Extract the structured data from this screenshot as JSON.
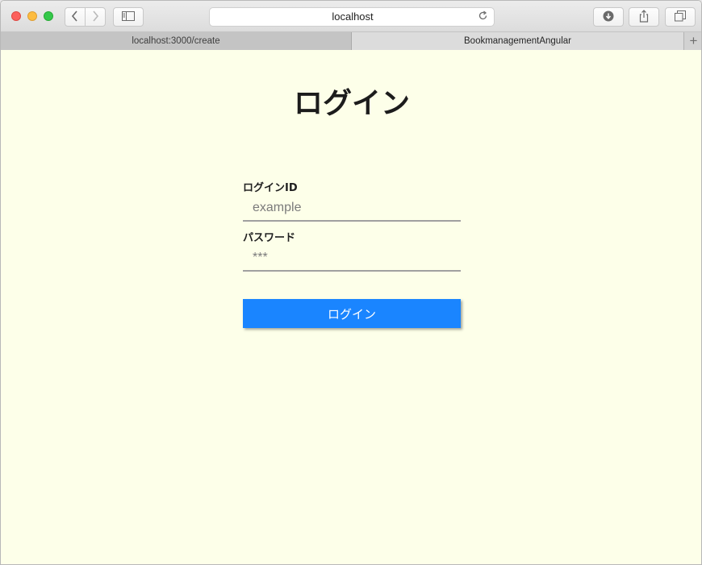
{
  "browser": {
    "address": "localhost",
    "tabs": [
      {
        "label": "localhost:3000/create"
      },
      {
        "label": "BookmanagementAngular"
      }
    ],
    "icons": {
      "back": "chevron-left-icon",
      "forward": "chevron-right-icon",
      "sidebar": "sidebar-icon",
      "reload": "reload-icon",
      "download": "download-icon",
      "share": "share-icon",
      "tabs": "tabs-overview-icon",
      "new_tab": "plus-icon"
    }
  },
  "page": {
    "title": "ログイン",
    "login_id": {
      "label": "ログインID",
      "placeholder": "example",
      "value": ""
    },
    "password": {
      "label": "パスワード",
      "placeholder": "***",
      "value": ""
    },
    "submit_label": "ログイン"
  },
  "colors": {
    "page_background": "#fdffe9",
    "button": "#1a85ff",
    "button_text": "#ffffff"
  }
}
